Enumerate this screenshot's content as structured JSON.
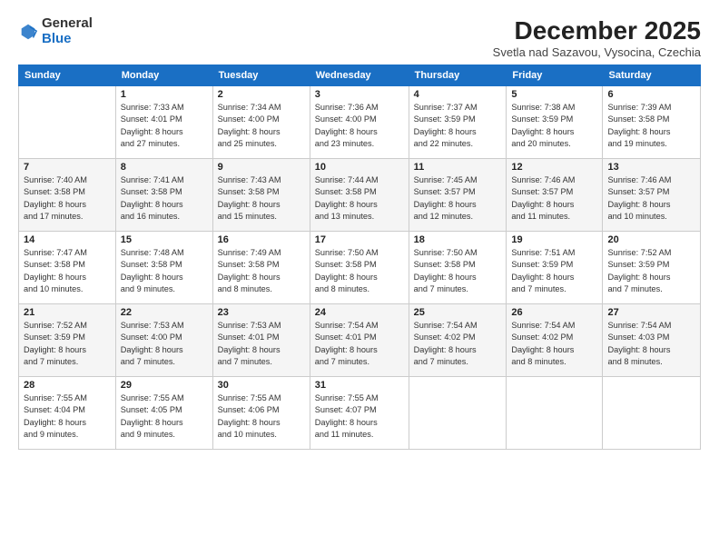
{
  "header": {
    "logo": {
      "line1": "General",
      "line2": "Blue"
    },
    "title": "December 2025",
    "location": "Svetla nad Sazavou, Vysocina, Czechia"
  },
  "weekdays": [
    "Sunday",
    "Monday",
    "Tuesday",
    "Wednesday",
    "Thursday",
    "Friday",
    "Saturday"
  ],
  "weeks": [
    [
      {
        "day": "",
        "info": ""
      },
      {
        "day": "1",
        "info": "Sunrise: 7:33 AM\nSunset: 4:01 PM\nDaylight: 8 hours\nand 27 minutes."
      },
      {
        "day": "2",
        "info": "Sunrise: 7:34 AM\nSunset: 4:00 PM\nDaylight: 8 hours\nand 25 minutes."
      },
      {
        "day": "3",
        "info": "Sunrise: 7:36 AM\nSunset: 4:00 PM\nDaylight: 8 hours\nand 23 minutes."
      },
      {
        "day": "4",
        "info": "Sunrise: 7:37 AM\nSunset: 3:59 PM\nDaylight: 8 hours\nand 22 minutes."
      },
      {
        "day": "5",
        "info": "Sunrise: 7:38 AM\nSunset: 3:59 PM\nDaylight: 8 hours\nand 20 minutes."
      },
      {
        "day": "6",
        "info": "Sunrise: 7:39 AM\nSunset: 3:58 PM\nDaylight: 8 hours\nand 19 minutes."
      }
    ],
    [
      {
        "day": "7",
        "info": "Sunrise: 7:40 AM\nSunset: 3:58 PM\nDaylight: 8 hours\nand 17 minutes."
      },
      {
        "day": "8",
        "info": "Sunrise: 7:41 AM\nSunset: 3:58 PM\nDaylight: 8 hours\nand 16 minutes."
      },
      {
        "day": "9",
        "info": "Sunrise: 7:43 AM\nSunset: 3:58 PM\nDaylight: 8 hours\nand 15 minutes."
      },
      {
        "day": "10",
        "info": "Sunrise: 7:44 AM\nSunset: 3:58 PM\nDaylight: 8 hours\nand 13 minutes."
      },
      {
        "day": "11",
        "info": "Sunrise: 7:45 AM\nSunset: 3:57 PM\nDaylight: 8 hours\nand 12 minutes."
      },
      {
        "day": "12",
        "info": "Sunrise: 7:46 AM\nSunset: 3:57 PM\nDaylight: 8 hours\nand 11 minutes."
      },
      {
        "day": "13",
        "info": "Sunrise: 7:46 AM\nSunset: 3:57 PM\nDaylight: 8 hours\nand 10 minutes."
      }
    ],
    [
      {
        "day": "14",
        "info": "Sunrise: 7:47 AM\nSunset: 3:58 PM\nDaylight: 8 hours\nand 10 minutes."
      },
      {
        "day": "15",
        "info": "Sunrise: 7:48 AM\nSunset: 3:58 PM\nDaylight: 8 hours\nand 9 minutes."
      },
      {
        "day": "16",
        "info": "Sunrise: 7:49 AM\nSunset: 3:58 PM\nDaylight: 8 hours\nand 8 minutes."
      },
      {
        "day": "17",
        "info": "Sunrise: 7:50 AM\nSunset: 3:58 PM\nDaylight: 8 hours\nand 8 minutes."
      },
      {
        "day": "18",
        "info": "Sunrise: 7:50 AM\nSunset: 3:58 PM\nDaylight: 8 hours\nand 7 minutes."
      },
      {
        "day": "19",
        "info": "Sunrise: 7:51 AM\nSunset: 3:59 PM\nDaylight: 8 hours\nand 7 minutes."
      },
      {
        "day": "20",
        "info": "Sunrise: 7:52 AM\nSunset: 3:59 PM\nDaylight: 8 hours\nand 7 minutes."
      }
    ],
    [
      {
        "day": "21",
        "info": "Sunrise: 7:52 AM\nSunset: 3:59 PM\nDaylight: 8 hours\nand 7 minutes."
      },
      {
        "day": "22",
        "info": "Sunrise: 7:53 AM\nSunset: 4:00 PM\nDaylight: 8 hours\nand 7 minutes."
      },
      {
        "day": "23",
        "info": "Sunrise: 7:53 AM\nSunset: 4:01 PM\nDaylight: 8 hours\nand 7 minutes."
      },
      {
        "day": "24",
        "info": "Sunrise: 7:54 AM\nSunset: 4:01 PM\nDaylight: 8 hours\nand 7 minutes."
      },
      {
        "day": "25",
        "info": "Sunrise: 7:54 AM\nSunset: 4:02 PM\nDaylight: 8 hours\nand 7 minutes."
      },
      {
        "day": "26",
        "info": "Sunrise: 7:54 AM\nSunset: 4:02 PM\nDaylight: 8 hours\nand 8 minutes."
      },
      {
        "day": "27",
        "info": "Sunrise: 7:54 AM\nSunset: 4:03 PM\nDaylight: 8 hours\nand 8 minutes."
      }
    ],
    [
      {
        "day": "28",
        "info": "Sunrise: 7:55 AM\nSunset: 4:04 PM\nDaylight: 8 hours\nand 9 minutes."
      },
      {
        "day": "29",
        "info": "Sunrise: 7:55 AM\nSunset: 4:05 PM\nDaylight: 8 hours\nand 9 minutes."
      },
      {
        "day": "30",
        "info": "Sunrise: 7:55 AM\nSunset: 4:06 PM\nDaylight: 8 hours\nand 10 minutes."
      },
      {
        "day": "31",
        "info": "Sunrise: 7:55 AM\nSunset: 4:07 PM\nDaylight: 8 hours\nand 11 minutes."
      },
      {
        "day": "",
        "info": ""
      },
      {
        "day": "",
        "info": ""
      },
      {
        "day": "",
        "info": ""
      }
    ]
  ]
}
